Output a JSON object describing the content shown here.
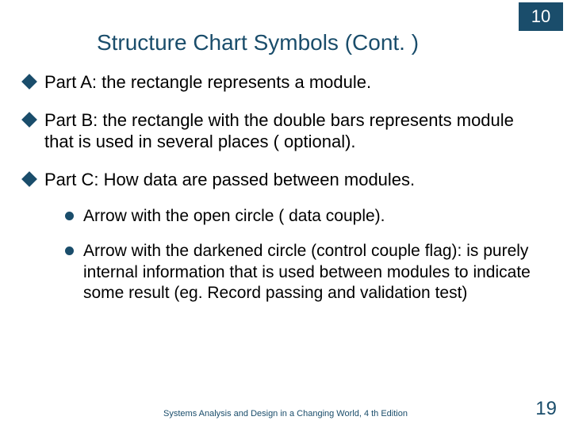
{
  "chapter": "10",
  "title": "Structure Chart Symbols (Cont. )",
  "bullets": [
    {
      "text": "Part A: the rectangle represents a module."
    },
    {
      "text": "Part B: the rectangle with the double bars represents module that is used in several places ( optional)."
    },
    {
      "text": "Part C: How data are passed between modules."
    }
  ],
  "subbullets": [
    {
      "text": "Arrow with the open circle ( data couple)."
    },
    {
      "text": "Arrow with the darkened circle (control couple flag): is purely internal information that is used between modules to indicate some result (eg. Record passing and validation test)"
    }
  ],
  "footer": "Systems Analysis and Design in a Changing World, 4 th Edition",
  "page": "19"
}
